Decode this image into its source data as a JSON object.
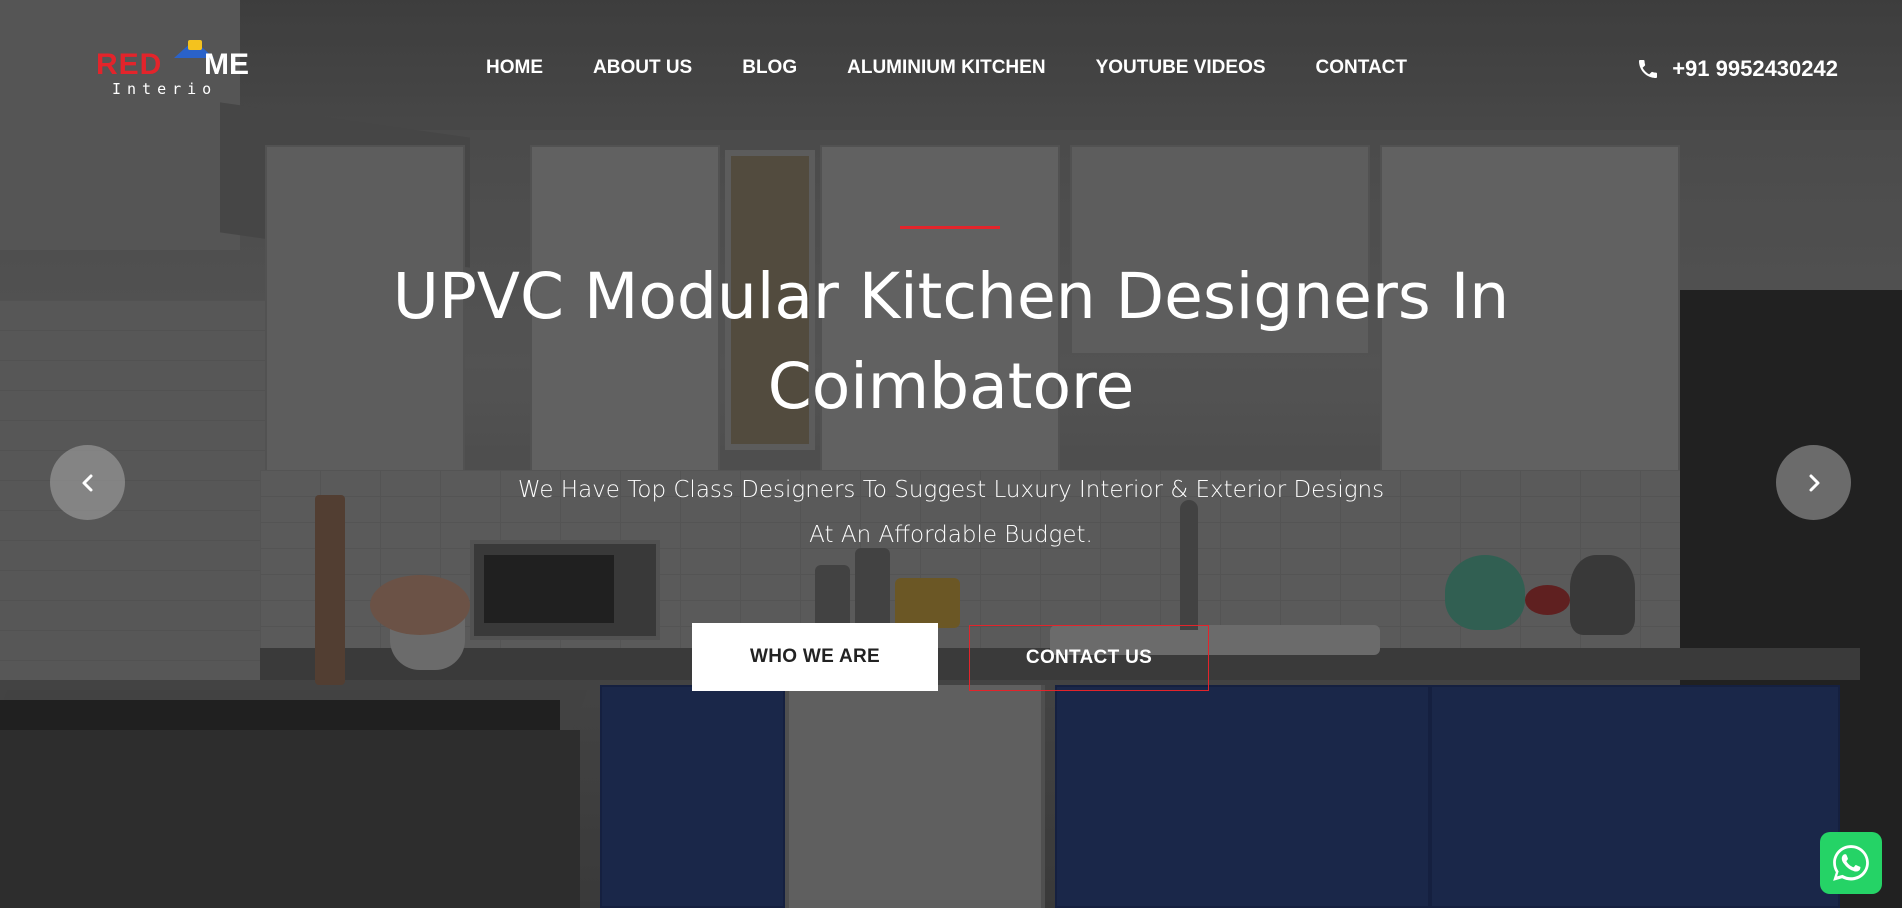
{
  "brand": {
    "logo_part1": "RED",
    "logo_part2": "ME",
    "logo_sub": "Interio",
    "accent_color": "#e3242b"
  },
  "nav": {
    "items": [
      {
        "label": "HOME"
      },
      {
        "label": "ABOUT US"
      },
      {
        "label": "BLOG"
      },
      {
        "label": "ALUMINIUM KITCHEN"
      },
      {
        "label": "YOUTUBE VIDEOS"
      },
      {
        "label": "CONTACT"
      }
    ]
  },
  "header": {
    "phone_icon": "phone-icon",
    "phone": "+91 9952430242"
  },
  "hero": {
    "title": "UPVC Modular Kitchen Designers In Coimbatore",
    "subtitle_line1": "We Have Top Class Designers To Suggest Luxury Interior & Exterior Designs",
    "subtitle_line2": "At An Affordable Budget.",
    "primary_button": "WHO WE ARE",
    "secondary_button": "CONTACT US"
  },
  "carousel": {
    "prev_icon": "chevron-left-icon",
    "next_icon": "chevron-right-icon"
  },
  "floating": {
    "whatsapp_icon": "whatsapp-icon",
    "whatsapp_color": "#25d366"
  }
}
